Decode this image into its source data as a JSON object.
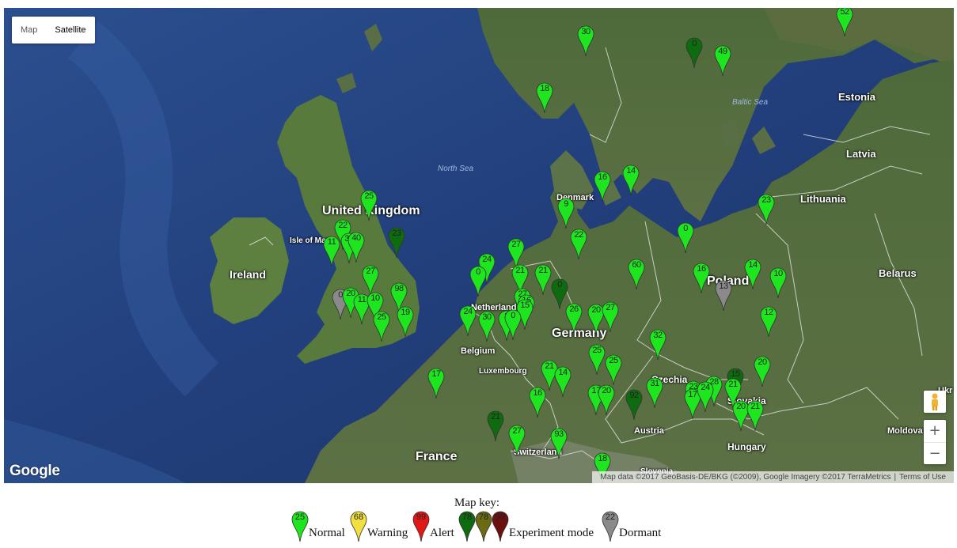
{
  "map_type": {
    "map_label": "Map",
    "satellite_label": "Satellite",
    "selected": "Satellite"
  },
  "zoom": {
    "in_label": "+",
    "out_label": "−"
  },
  "google_logo": "Google",
  "attribution": {
    "data": "Map data ©2017 GeoBasis-DE/BKG (©2009), Google Imagery ©2017 TerraMetrics",
    "terms": "Terms of Use"
  },
  "colors": {
    "normal": "#1ee61e",
    "warning": "#f0e040",
    "alert": "#e01818",
    "experiment_green": "#0f6b0f",
    "experiment_olive": "#6b6b14",
    "experiment_red": "#6b0f0f",
    "dormant": "#8a8a8a"
  },
  "labels": {
    "uk": "United Kingdom",
    "isle_of_man": "Isle of Man",
    "ireland": "Ireland",
    "north_sea": "North Sea",
    "denmark": "Denmark",
    "netherlands": "Netherlands",
    "belgium": "Belgium",
    "luxembourg": "Luxembourg",
    "germany": "Germany",
    "france": "France",
    "switzerland": "Switzerland",
    "austria": "Austria",
    "czechia": "Czechia",
    "slovakia": "Slovakia",
    "hungary": "Hungary",
    "slovenia": "Slovenia",
    "poland": "Poland",
    "lithuania": "Lithuania",
    "latvia": "Latvia",
    "estonia": "Estonia",
    "belarus": "Belarus",
    "moldova": "Moldova",
    "baltic_sea": "Baltic Sea",
    "ukraine": "Ukr"
  },
  "markers": [
    {
      "v": "30",
      "s": "normal"
    },
    {
      "v": "52",
      "s": "normal"
    },
    {
      "v": "49",
      "s": "normal"
    },
    {
      "v": "0",
      "s": "experiment_green"
    },
    {
      "v": "18",
      "s": "normal"
    },
    {
      "v": "16",
      "s": "normal"
    },
    {
      "v": "14",
      "s": "normal"
    },
    {
      "v": "9",
      "s": "normal"
    },
    {
      "v": "25",
      "s": "normal"
    },
    {
      "v": "23",
      "s": "normal"
    },
    {
      "v": "0",
      "s": "normal"
    },
    {
      "v": "22",
      "s": "normal"
    },
    {
      "v": "23",
      "s": "experiment_green"
    },
    {
      "v": "22",
      "s": "normal"
    },
    {
      "v": "11",
      "s": "normal"
    },
    {
      "v": "34",
      "s": "normal"
    },
    {
      "v": "40",
      "s": "normal"
    },
    {
      "v": "27",
      "s": "normal"
    },
    {
      "v": "24",
      "s": "normal"
    },
    {
      "v": "27",
      "s": "normal"
    },
    {
      "v": "60",
      "s": "normal"
    },
    {
      "v": "14",
      "s": "normal"
    },
    {
      "v": "16",
      "s": "normal"
    },
    {
      "v": "10",
      "s": "normal"
    },
    {
      "v": "13",
      "s": "dormant"
    },
    {
      "v": "0",
      "s": "normal"
    },
    {
      "v": "21",
      "s": "normal"
    },
    {
      "v": "21",
      "s": "normal"
    },
    {
      "v": "0",
      "s": "experiment_green"
    },
    {
      "v": "27",
      "s": "normal"
    },
    {
      "v": "0",
      "s": "dormant"
    },
    {
      "v": "20",
      "s": "normal"
    },
    {
      "v": "11",
      "s": "normal"
    },
    {
      "v": "10",
      "s": "normal"
    },
    {
      "v": "98",
      "s": "normal"
    },
    {
      "v": "25",
      "s": "normal"
    },
    {
      "v": "19",
      "s": "normal"
    },
    {
      "v": "16",
      "s": "normal"
    },
    {
      "v": "15",
      "s": "normal"
    },
    {
      "v": "24",
      "s": "normal"
    },
    {
      "v": "30",
      "s": "normal"
    },
    {
      "v": "8",
      "s": "normal"
    },
    {
      "v": "0",
      "s": "normal"
    },
    {
      "v": "26",
      "s": "normal"
    },
    {
      "v": "20",
      "s": "normal"
    },
    {
      "v": "27",
      "s": "normal"
    },
    {
      "v": "12",
      "s": "normal"
    },
    {
      "v": "32",
      "s": "normal"
    },
    {
      "v": "25",
      "s": "normal"
    },
    {
      "v": "25",
      "s": "normal"
    },
    {
      "v": "21",
      "s": "normal"
    },
    {
      "v": "14",
      "s": "normal"
    },
    {
      "v": "20",
      "s": "normal"
    },
    {
      "v": "17",
      "s": "normal"
    },
    {
      "v": "16",
      "s": "normal"
    },
    {
      "v": "17",
      "s": "normal"
    },
    {
      "v": "20",
      "s": "normal"
    },
    {
      "v": "92",
      "s": "experiment_green"
    },
    {
      "v": "31",
      "s": "normal"
    },
    {
      "v": "15",
      "s": "experiment_green"
    },
    {
      "v": "23",
      "s": "normal"
    },
    {
      "v": "17",
      "s": "normal"
    },
    {
      "v": "28",
      "s": "normal"
    },
    {
      "v": "24",
      "s": "normal"
    },
    {
      "v": "21",
      "s": "normal"
    },
    {
      "v": "20",
      "s": "normal"
    },
    {
      "v": "21",
      "s": "normal"
    },
    {
      "v": "21",
      "s": "experiment_green"
    },
    {
      "v": "27",
      "s": "normal"
    },
    {
      "v": "93",
      "s": "normal"
    },
    {
      "v": "18",
      "s": "normal"
    }
  ],
  "legend": {
    "title": "Map key:",
    "normal": {
      "value": "25",
      "label": "Normal"
    },
    "warning": {
      "value": "68",
      "label": "Warning"
    },
    "alert": {
      "value": "99",
      "label": "Alert"
    },
    "experiment": {
      "values": [
        "78",
        "78",
        "99"
      ],
      "label": "Experiment mode"
    },
    "dormant": {
      "value": "22",
      "label": "Dormant"
    }
  }
}
